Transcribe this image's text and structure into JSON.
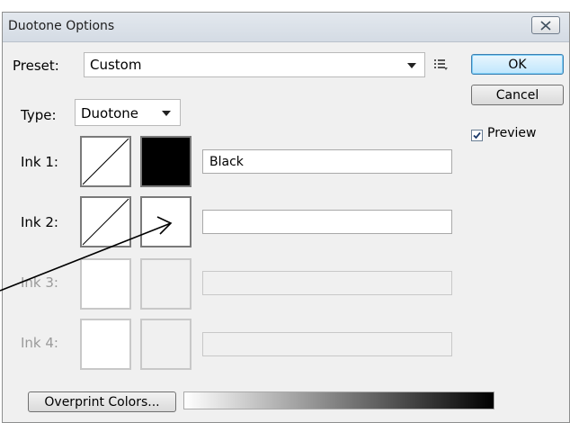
{
  "dialog": {
    "title": "Duotone Options",
    "close_icon": "close-icon"
  },
  "preset": {
    "label": "Preset:",
    "value": "Custom",
    "menu_icon": "preset-options-icon"
  },
  "type": {
    "label": "Type:",
    "value": "Duotone"
  },
  "buttons": {
    "ok": "OK",
    "cancel": "Cancel",
    "overprint": "Overprint Colors..."
  },
  "preview": {
    "label": "Preview",
    "checked": true
  },
  "inks": [
    {
      "label": "Ink 1:",
      "name": "Black",
      "enabled": true
    },
    {
      "label": "Ink 2:",
      "name": "",
      "enabled": true
    },
    {
      "label": "Ink 3:",
      "name": "",
      "enabled": false
    },
    {
      "label": "Ink 4:",
      "name": "",
      "enabled": false
    }
  ],
  "colors": {
    "ink1_swatch": "#000000",
    "default_button_border": "#3c7fb1"
  }
}
